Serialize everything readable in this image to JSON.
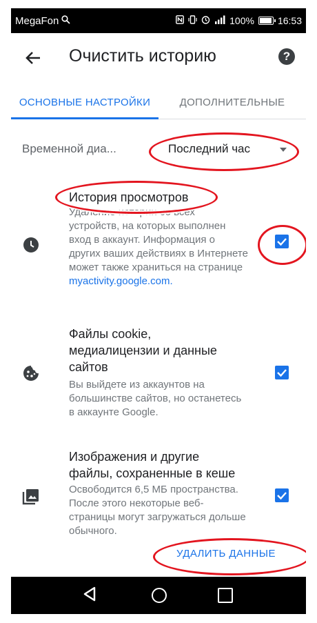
{
  "status_bar": {
    "carrier": "MegaFon",
    "battery": "100%",
    "battery_level": 1.0,
    "time": "16:53"
  },
  "app_bar": {
    "title": "Очистить историю"
  },
  "tabs": [
    {
      "label": "ОСНОВНЫЕ НАСТРОЙКИ",
      "active": true
    },
    {
      "label": "ДОПОЛНИТЕЛЬНЫЕ",
      "active": false
    }
  ],
  "time_range": {
    "label": "Временной диа...",
    "value": "Последний час"
  },
  "items": [
    {
      "title": "История просмотров",
      "description": "Удаление истории со всех устройств, на которых выполнен вход в аккаунт. Информация о других ваших действиях в Интернете может также храниться на странице",
      "link": "myactivity.google.com.",
      "checked": true,
      "icon": "clock-icon"
    },
    {
      "title": "Файлы cookie, медиалицензии и данные сайтов",
      "description": "Вы выйдете из аккаунтов на большинстве сайтов, но останетесь в аккаунте Google.",
      "checked": true,
      "icon": "cookie-icon"
    },
    {
      "title": "Изображения и другие файлы, сохраненные в кеше",
      "description": "Освободится 6,5 МБ пространства. После этого некоторые веб-страницы могут загружаться дольше обычного.",
      "checked": true,
      "icon": "image-icon"
    }
  ],
  "clear_button": "УДАЛИТЬ ДАННЫЕ",
  "colors": {
    "accent": "#1a73e8",
    "annotation": "#e3151f"
  }
}
